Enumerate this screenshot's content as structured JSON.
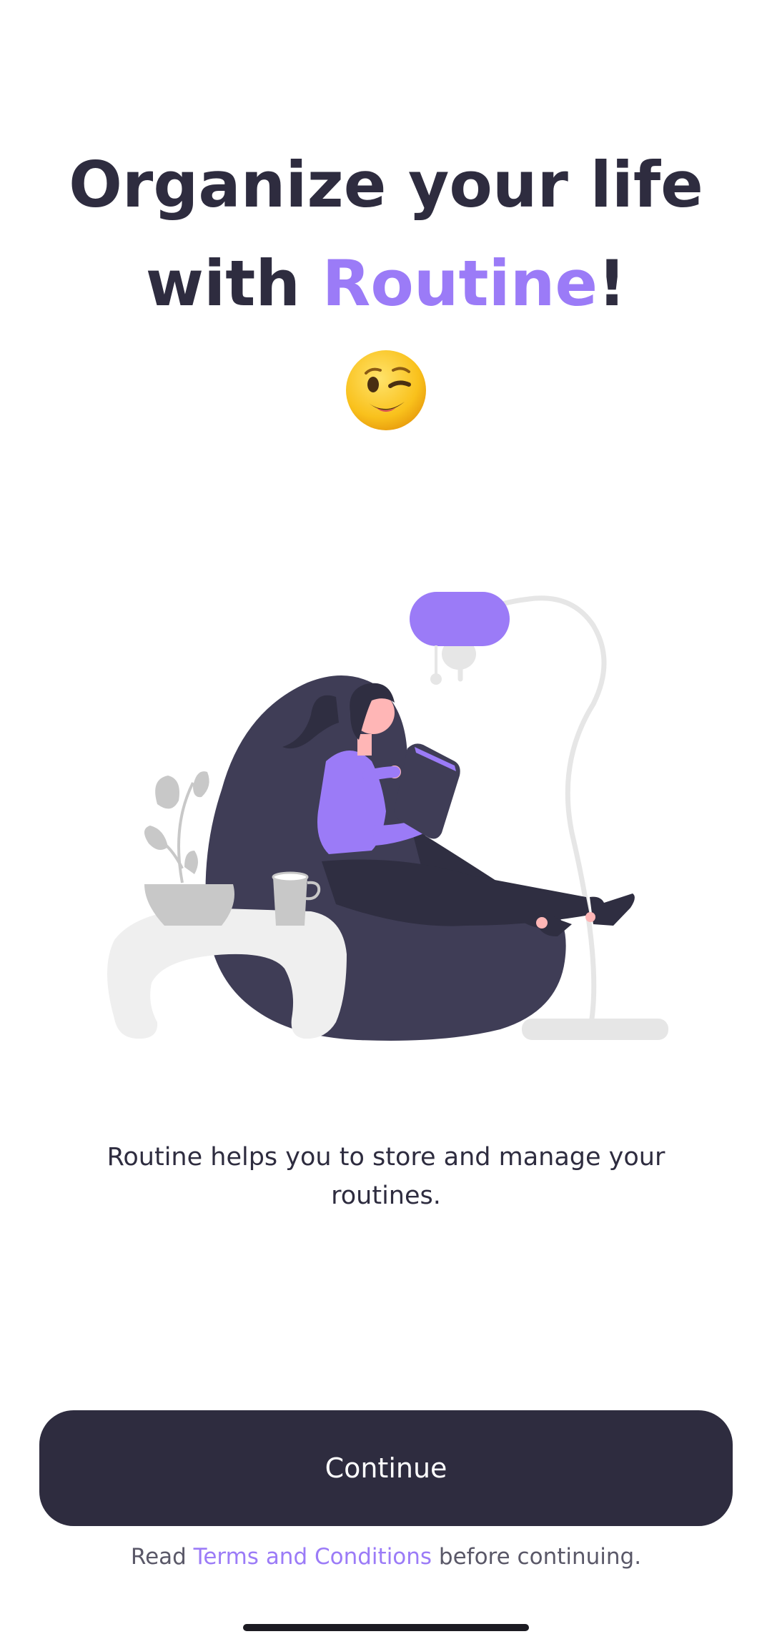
{
  "header": {
    "title_line1": "Organize your life",
    "title_with": "with ",
    "title_brand": "Routine",
    "title_end": "!"
  },
  "icons": {
    "hero_emoji": "winking-face-emoji",
    "illustration": "woman-reading-tablet-in-beanbag-illustration"
  },
  "body": {
    "description": "Routine helps you to store and manage your routines."
  },
  "actions": {
    "continue_label": "Continue"
  },
  "footer": {
    "prefix": "Read ",
    "terms_link": "Terms and Conditions",
    "suffix": " before continuing."
  },
  "colors": {
    "primary_dark": "#2e2c3f",
    "accent_purple": "#9b7bf7",
    "illustration_dark": "#3f3d56",
    "light_gray": "#e6e6e6",
    "skin": "#ffb6b6"
  }
}
